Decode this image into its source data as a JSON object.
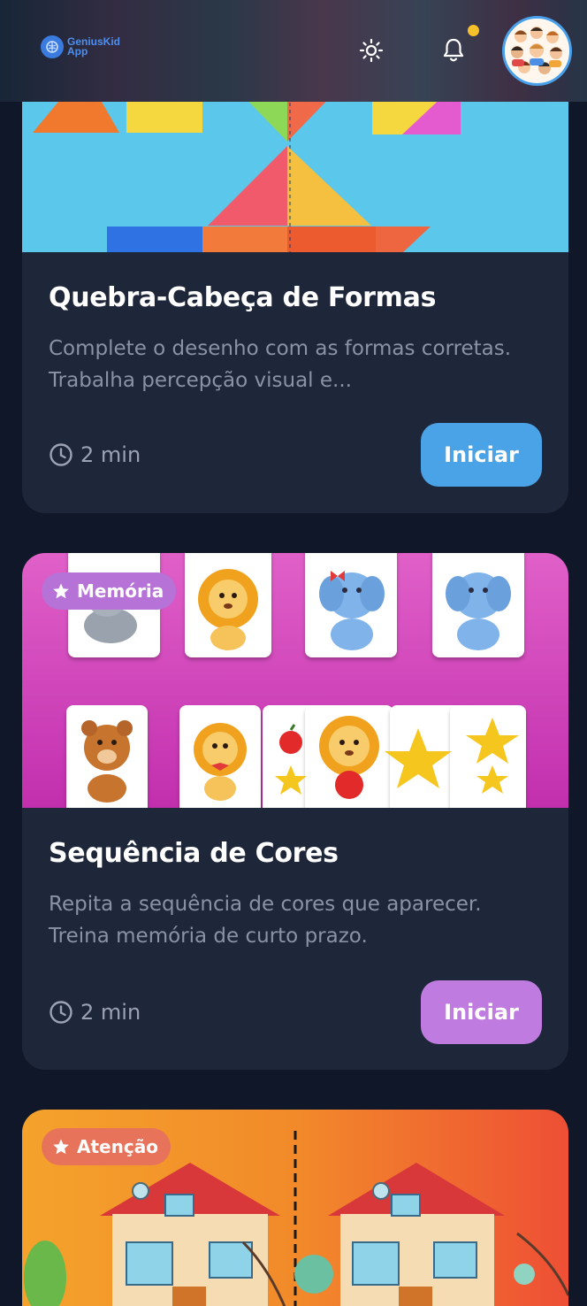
{
  "header": {
    "logo_line1": "GeniusKid",
    "logo_line2": "App",
    "theme_icon": "sun-icon",
    "notifications_icon": "bell-icon",
    "avatar_icon": "kids-avatar"
  },
  "activities": [
    {
      "title": "Quebra-Cabeça de Formas",
      "description": "Complete o desenho com as formas corretas. Trabalha percepção visual e...",
      "duration": "2 min",
      "button": "Iniciar",
      "accent": "#4aa3e6"
    },
    {
      "badge": "Memória",
      "title": "Sequência de Cores",
      "description": "Repita a sequência de cores que aparecer. Treina memória de curto prazo.",
      "duration": "2 min",
      "button": "Iniciar",
      "accent": "#c07be0"
    },
    {
      "badge": "Atenção",
      "accent": "#e7745a"
    }
  ],
  "colors": {
    "background": "#0f1729",
    "card": "#1e2639",
    "notification_dot": "#f4c12a"
  }
}
